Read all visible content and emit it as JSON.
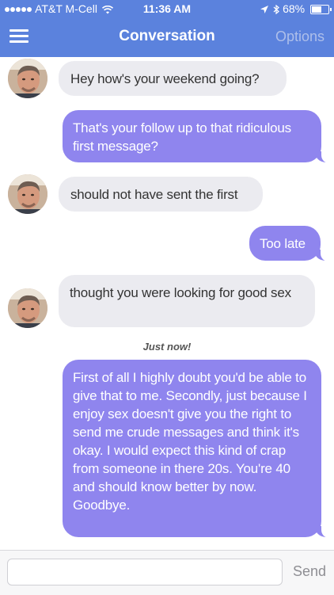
{
  "status_bar": {
    "carrier": "AT&T M-Cell",
    "time": "11:36 AM",
    "battery": "68%",
    "battery_level": 0.68,
    "icons": [
      "signal-dots-icon",
      "wifi-icon",
      "location-arrow-icon",
      "bluetooth-icon",
      "battery-icon"
    ]
  },
  "nav": {
    "menu_icon": "hamburger-menu-icon",
    "title": "Conversation",
    "options_label": "Options"
  },
  "messages": [
    {
      "direction": "received",
      "text": "Hey how's your weekend going?"
    },
    {
      "direction": "sent",
      "text": "That's your follow up to that ridiculous first message?"
    },
    {
      "direction": "received",
      "text": "should not have sent the first"
    },
    {
      "direction": "sent",
      "text": "Too late"
    },
    {
      "direction": "received",
      "text": "thought you were looking for good sex"
    },
    {
      "direction": "sent",
      "text": "First of all I highly doubt you'd be able to give that to me. Secondly, just because I enjoy sex doesn't give you the right to send me crude messages and think it's okay. I would expect this kind of crap from someone in there 20s. You're 40 and should know better by now. Goodbye."
    }
  ],
  "timestamp": "Just now!",
  "compose": {
    "value": "",
    "placeholder": "",
    "send_label": "Send"
  },
  "colors": {
    "header": "#5b82dd",
    "sent_bubble": "#8f85ee",
    "received_bubble": "#ebebf0"
  }
}
